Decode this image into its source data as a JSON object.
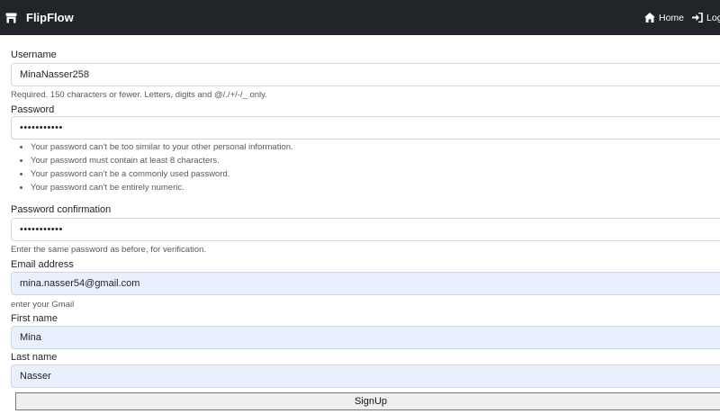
{
  "navbar": {
    "brand": "FlipFlow",
    "links": [
      {
        "label": "Home",
        "icon": "home-icon"
      },
      {
        "label": "Login",
        "icon": "login-icon"
      }
    ],
    "colors": {
      "background": "#212529",
      "text": "#ffffff"
    }
  },
  "form": {
    "username": {
      "label": "Username",
      "value": "MinaNasser258",
      "help": "Required. 150 characters or fewer. Letters, digits and @/./+/-/_ only."
    },
    "password": {
      "label": "Password",
      "value": "•••••••••••",
      "rules": [
        "Your password can’t be too similar to your other personal information.",
        "Your password must contain at least 8 characters.",
        "Your password can’t be a commonly used password.",
        "Your password can’t be entirely numeric."
      ]
    },
    "password_confirmation": {
      "label": "Password confirmation",
      "value": "•••••••••••",
      "help": "Enter the same password as before, for verification."
    },
    "email": {
      "label": "Email address",
      "value": "mina.nasser54@gmail.com",
      "help": "enter your Gmail"
    },
    "first_name": {
      "label": "First name",
      "value": "Mina"
    },
    "last_name": {
      "label": "Last name",
      "value": "Nasser"
    },
    "submit_label": "SignUp",
    "autofill_color": "#e8f0fe"
  }
}
